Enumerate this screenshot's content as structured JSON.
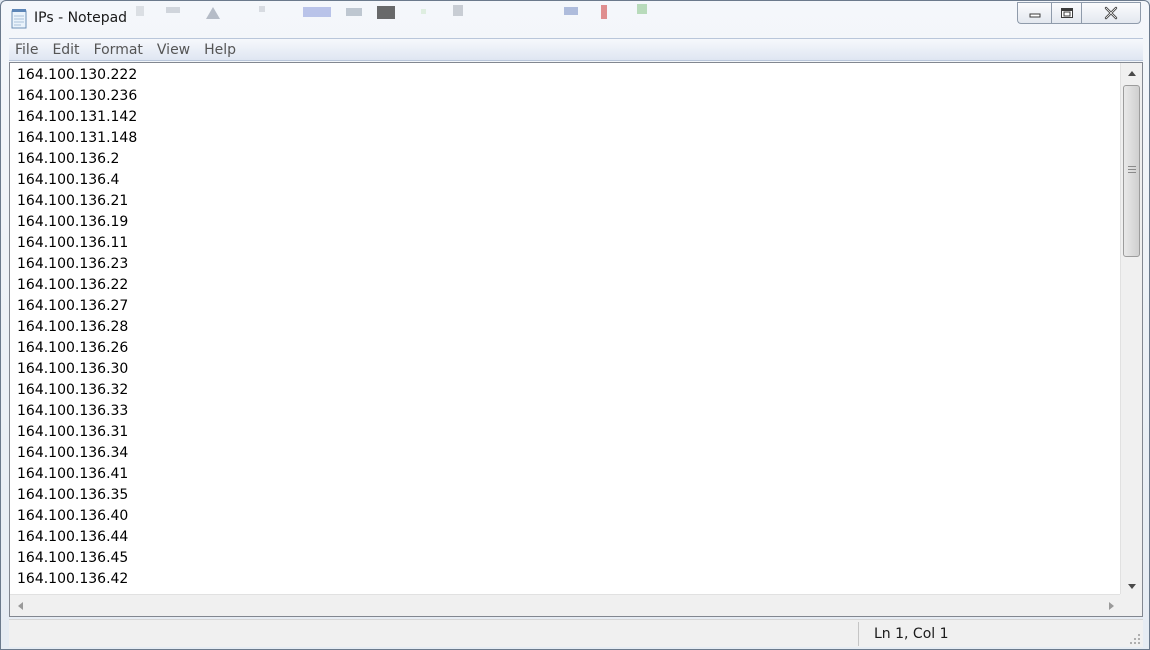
{
  "window": {
    "title": "IPs - Notepad",
    "icon": "notepad-icon"
  },
  "caption_buttons": {
    "minimize_icon": "minimize-icon",
    "maximize_icon": "maximize-icon",
    "close_icon": "close-icon"
  },
  "menu": {
    "items": [
      "File",
      "Edit",
      "Format",
      "View",
      "Help"
    ]
  },
  "editor": {
    "lines": [
      "164.100.130.222",
      "164.100.130.236",
      "164.100.131.142",
      "164.100.131.148",
      "164.100.136.2",
      "164.100.136.4",
      "164.100.136.21",
      "164.100.136.19",
      "164.100.136.11",
      "164.100.136.23",
      "164.100.136.22",
      "164.100.136.27",
      "164.100.136.28",
      "164.100.136.26",
      "164.100.136.30",
      "164.100.136.32",
      "164.100.136.33",
      "164.100.136.31",
      "164.100.136.34",
      "164.100.136.41",
      "164.100.136.35",
      "164.100.136.40",
      "164.100.136.44",
      "164.100.136.45",
      "164.100.136.42"
    ]
  },
  "status": {
    "position": "Ln 1, Col 1"
  },
  "colors": {
    "menubar_bg": "#dfe6f2",
    "editor_bg": "#ffffff",
    "text": "#000000"
  }
}
